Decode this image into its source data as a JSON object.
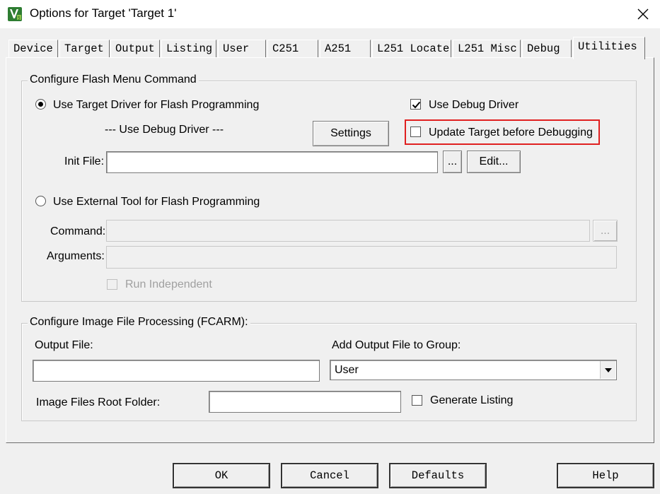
{
  "window": {
    "title": "Options for Target 'Target 1'",
    "icon": "keil-uvision-icon",
    "close_icon": "close-icon"
  },
  "tabs": [
    {
      "label": "Device"
    },
    {
      "label": "Target"
    },
    {
      "label": "Output"
    },
    {
      "label": "Listing"
    },
    {
      "label": "User"
    },
    {
      "label": "C251"
    },
    {
      "label": "A251"
    },
    {
      "label": "L251 Locate"
    },
    {
      "label": "L251 Misc"
    },
    {
      "label": "Debug"
    },
    {
      "label": "Utilities",
      "active": true
    }
  ],
  "flash_group": {
    "title": "Configure Flash Menu Command",
    "use_target_driver_label": "Use Target Driver for Flash Programming",
    "use_target_driver_selected": true,
    "debug_driver_text": "--- Use Debug Driver ---",
    "settings_label": "Settings",
    "use_debug_driver_label": "Use Debug Driver",
    "use_debug_driver_checked": true,
    "update_target_label": "Update Target before Debugging",
    "update_target_checked": false,
    "init_file_label": "Init File:",
    "init_file_value": "",
    "browse_label": "...",
    "edit_label": "Edit...",
    "use_external_tool_label": "Use External Tool for Flash Programming",
    "use_external_tool_selected": false,
    "command_label": "Command:",
    "command_value": "",
    "command_browse_label": "...",
    "arguments_label": "Arguments:",
    "arguments_value": "",
    "run_independent_label": "Run Independent",
    "run_independent_checked": false
  },
  "image_group": {
    "title": "Configure Image File Processing (FCARM):",
    "output_file_label": "Output File:",
    "output_file_value": "",
    "add_output_label": "Add Output File  to Group:",
    "group_selected": "User",
    "root_folder_label": "Image Files Root Folder:",
    "root_folder_value": "",
    "generate_listing_label": "Generate Listing",
    "generate_listing_checked": false
  },
  "footer": {
    "ok_label": "OK",
    "cancel_label": "Cancel",
    "defaults_label": "Defaults",
    "help_label": "Help"
  },
  "colors": {
    "highlight": "#e02020",
    "window_bg": "#f0f0f0"
  }
}
